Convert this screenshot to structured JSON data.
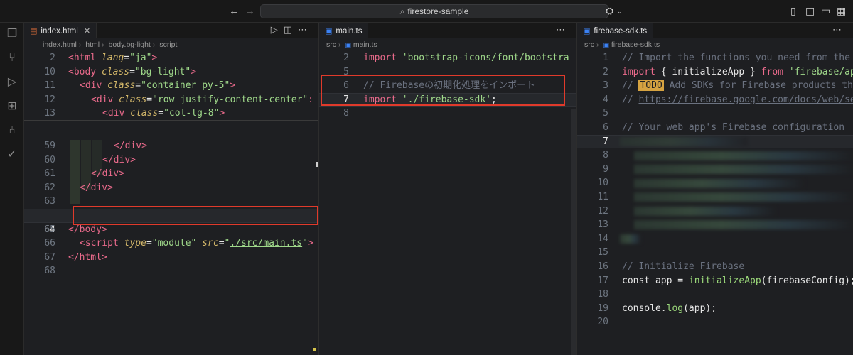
{
  "titlebar": {
    "back_icon": "arrow-left-icon",
    "forward_icon": "arrow-right-icon",
    "search_text": "firestore-sample",
    "search_icon": "search-icon"
  },
  "pane1": {
    "tab_label": "index.html",
    "tab_icon_color": "#e8703a",
    "breadcrumb": [
      "index.html",
      "html",
      "body.bg-light",
      "script"
    ],
    "sticky": [
      {
        "n": "2",
        "t": "<html lang=\"ja\">"
      },
      {
        "n": "10",
        "t": "<body class=\"bg-light\">"
      },
      {
        "n": "11",
        "t": "<div class=\"container py-5\">"
      },
      {
        "n": "12",
        "t": "<div class=\"row justify-content-center\""
      },
      {
        "n": "13",
        "t": "<div class=\"col-lg-8\">"
      }
    ],
    "lines": [
      {
        "n": "59",
        "t": "</div>"
      },
      {
        "n": "60",
        "t": "</div>"
      },
      {
        "n": "61",
        "t": "</div>"
      },
      {
        "n": "62",
        "t": "</div>"
      },
      {
        "n": "63",
        "t": ""
      },
      {
        "n": "64",
        "t": "<script type=\"module\" src=\"./src/main.ts\">"
      },
      {
        "n": "65",
        "t": "</body>"
      },
      {
        "n": "66",
        "t": ""
      },
      {
        "n": "67",
        "t": "</html>"
      },
      {
        "n": "68",
        "t": ""
      }
    ]
  },
  "pane2": {
    "tab_label": "main.ts",
    "tab_icon_color": "#3b82f6",
    "breadcrumb": [
      "src",
      "main.ts"
    ],
    "lines": [
      {
        "n": "2",
        "t": "import 'bootstrap-icons/font/bootstra"
      },
      {
        "n": "5",
        "t": ""
      },
      {
        "n": "6",
        "t": "// Firebaseの初期化処理をインポート"
      },
      {
        "n": "7",
        "t": "import './firebase-sdk';"
      },
      {
        "n": "8",
        "t": ""
      }
    ]
  },
  "pane3": {
    "tab_label": "firebase-sdk.ts",
    "tab_icon_color": "#3b82f6",
    "breadcrumb": [
      "src",
      "firebase-sdk.ts"
    ],
    "lines": [
      {
        "n": "1",
        "t": "// Import the functions you need from the"
      },
      {
        "n": "2",
        "t": "import { initializeApp } from 'firebase/ap"
      },
      {
        "n": "3",
        "t": "// TODO Add SDKs for Firebase products th"
      },
      {
        "n": "4",
        "t": "// https://firebase.google.com/docs/web/se"
      },
      {
        "n": "5",
        "t": ""
      },
      {
        "n": "6",
        "t": "// Your web app's Firebase configuration"
      },
      {
        "n": "7",
        "t": ""
      },
      {
        "n": "8",
        "t": ""
      },
      {
        "n": "9",
        "t": ""
      },
      {
        "n": "10",
        "t": ""
      },
      {
        "n": "11",
        "t": ""
      },
      {
        "n": "12",
        "t": ""
      },
      {
        "n": "13",
        "t": ""
      },
      {
        "n": "14",
        "t": ""
      },
      {
        "n": "15",
        "t": ""
      },
      {
        "n": "16",
        "t": "// Initialize Firebase"
      },
      {
        "n": "17",
        "t": "const app = initializeApp(firebaseConfig);"
      },
      {
        "n": "18",
        "t": ""
      },
      {
        "n": "19",
        "t": "console.log(app);"
      },
      {
        "n": "20",
        "t": ""
      }
    ]
  },
  "colors": {
    "accent": "#3b82f6",
    "highlight_box": "#e03a2b",
    "todo_bg": "#d6a341"
  }
}
